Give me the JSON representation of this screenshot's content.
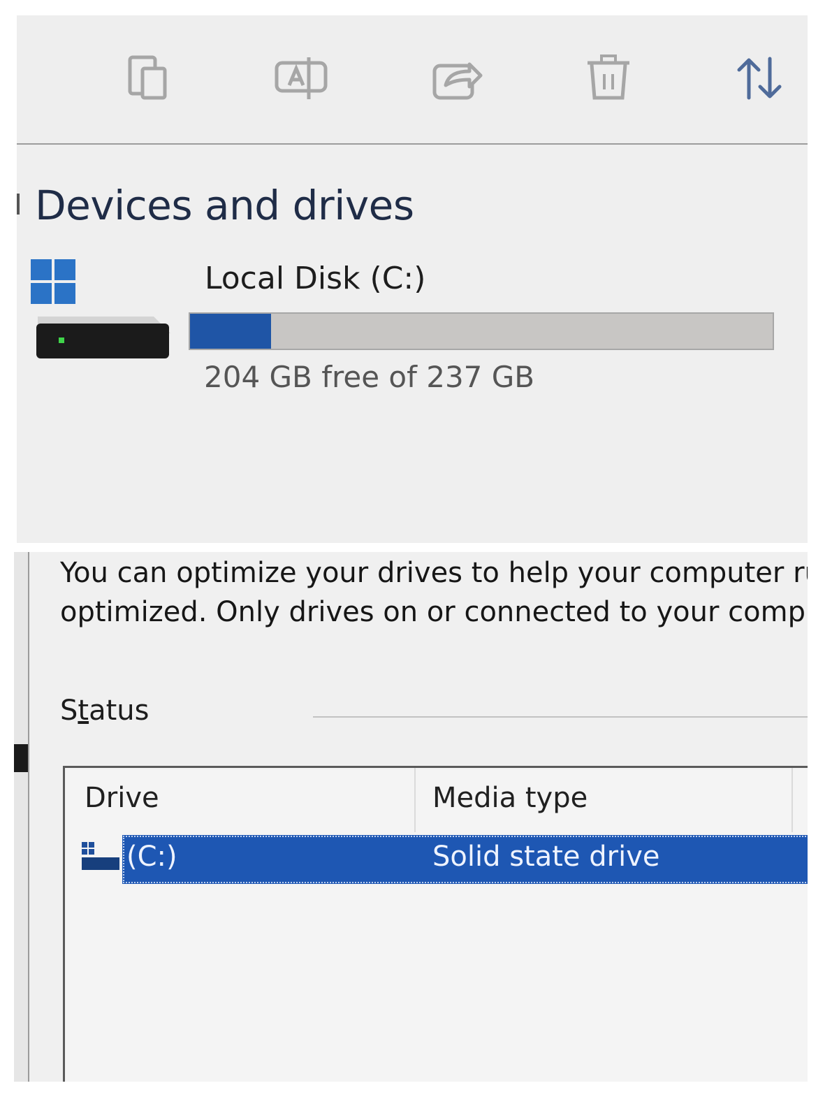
{
  "explorer": {
    "toolbar": [
      {
        "icon": "copy-icon"
      },
      {
        "icon": "rename-icon"
      },
      {
        "icon": "share-icon"
      },
      {
        "icon": "delete-icon"
      },
      {
        "icon": "sort-icon"
      }
    ],
    "section_title": "Devices and drives",
    "drive": {
      "name": "Local Disk (C:)",
      "usage_text": "204 GB free of 237 GB",
      "used_fraction": 0.139,
      "bar_color": "#1f55a6",
      "icon": "hard-drive-icon"
    }
  },
  "optimize": {
    "description_line1": "You can optimize your drives to help your computer ru",
    "description_line2": "optimized. Only drives on or connected to your compu",
    "status_label": "Status",
    "columns": {
      "drive": "Drive",
      "media_type": "Media type"
    },
    "rows": [
      {
        "drive": "(C:)",
        "media_type": "Solid state drive",
        "selected": true,
        "icon": "drive-icon"
      }
    ],
    "selection_color": "#1e57b3"
  }
}
